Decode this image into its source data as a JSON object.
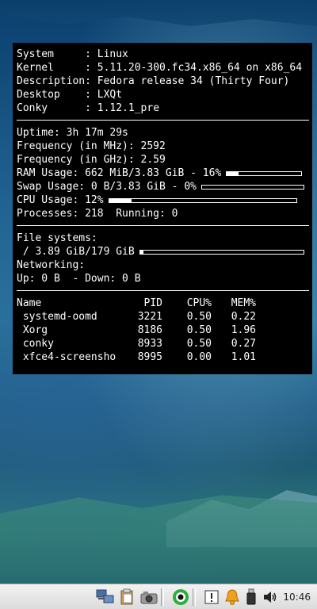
{
  "system_info": [
    {
      "label": "System     : ",
      "value": "Linux"
    },
    {
      "label": "Kernel     : ",
      "value": "5.11.20-300.fc34.x86_64 on x86_64"
    },
    {
      "label": "Description: ",
      "value": "Fedora release 34 (Thirty Four)"
    },
    {
      "label": "Desktop    : ",
      "value": "LXQt"
    },
    {
      "label": "Conky      : ",
      "value": "1.12.1_pre"
    }
  ],
  "stats": {
    "uptime": "Uptime: 3h 17m 29s",
    "freq_mhz": "Frequency (in MHz): 2592",
    "freq_ghz": "Frequency (in GHz): 2.59",
    "ram": "RAM Usage: 662 MiB/3.83 GiB - 16%",
    "ram_percent": 16,
    "swap": "Swap Usage: 0 B/3.83 GiB - 0%",
    "swap_percent": 0,
    "cpu": "CPU Usage: 12%",
    "cpu_percent": 12,
    "processes": "Processes: 218  Running: 0"
  },
  "filesystems": {
    "heading": "File systems:",
    "root": " / 3.89 GiB/179 GiB",
    "root_percent": 2,
    "net_heading": "Networking:",
    "net": "Up: 0 B  - Down: 0 B"
  },
  "processes": {
    "headers": {
      "name": "Name",
      "pid": "PID",
      "cpu": "CPU%",
      "mem": "MEM%"
    },
    "rows": [
      {
        "name": " systemd-oomd",
        "pid": "3221",
        "cpu": "0.50",
        "mem": "0.22"
      },
      {
        "name": " Xorg",
        "pid": "8186",
        "cpu": "0.50",
        "mem": "1.96"
      },
      {
        "name": " conky",
        "pid": "8933",
        "cpu": "0.50",
        "mem": "0.27"
      },
      {
        "name": " xfce4-screensho",
        "pid": "8995",
        "cpu": "0.00",
        "mem": "1.01"
      }
    ]
  },
  "taskbar": {
    "clock": "10:46",
    "icons": [
      "network-icon",
      "clipboard-icon",
      "screenshot-icon",
      "conky-icon",
      "notes-icon",
      "notification-bell-icon",
      "usb-drive-icon",
      "volume-icon"
    ],
    "accent_green": "#2fae3a",
    "bell_color": "#f0a020"
  }
}
